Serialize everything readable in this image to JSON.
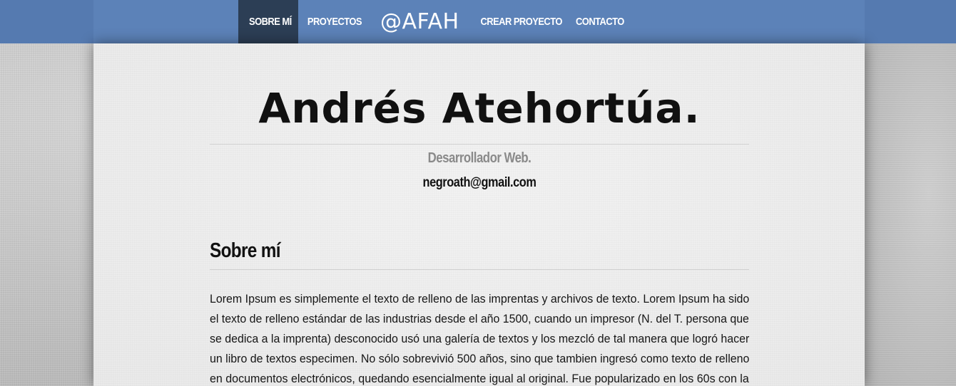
{
  "nav": {
    "items": [
      {
        "label": "SOBRE MÍ",
        "active": true
      },
      {
        "label": "PROYECTOS",
        "active": false
      },
      {
        "label": "CREAR PROYECTO",
        "active": false
      },
      {
        "label": "CONTACTO",
        "active": false
      }
    ],
    "logo": "@AFAH"
  },
  "header": {
    "name": "Andrés Atehortúa.",
    "role": "Desarrollador Web.",
    "email": "negroath@gmail.com"
  },
  "about": {
    "title": "Sobre mí",
    "lines": [
      "Lorem Ipsum es simplemente el texto de relleno de las imprentas y archivos de texto. Lorem Ipsum ha sido",
      "el texto de relleno estándar de las industrias desde el año 1500, cuando un impresor (N. del T. persona que",
      "se dedica a la imprenta) desconocido usó una galería de textos y los mezcló de tal manera que logró hacer",
      "un libro de textos especimen. No sólo sobrevivió 500 años, sino que tambien ingresó como texto de relleno",
      "en documentos electrónicos, quedando esencialmente igual al original. Fue popularizado en los 60s con la"
    ]
  },
  "colors": {
    "nav_background": "#5c82b8",
    "nav_active": "#2c3e55",
    "paper": "#efefef",
    "page_background": "#c9c9c9"
  }
}
